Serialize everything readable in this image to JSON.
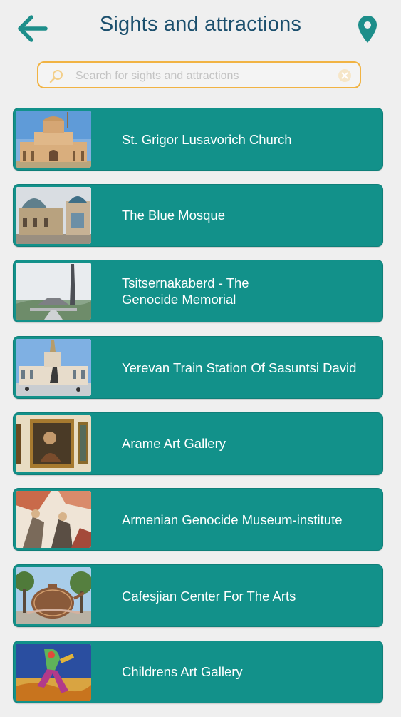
{
  "header": {
    "title": "Sights and attractions",
    "back_icon": "arrow-left-icon",
    "map_icon": "map-pin-icon",
    "accent_color": "#1d8e8a",
    "title_color": "#1b4f6d"
  },
  "search": {
    "placeholder": "Search for sights and attractions",
    "value": "",
    "border_color": "#f1b343"
  },
  "list": {
    "item_color": "#12918a",
    "items": [
      {
        "label": "St. Grigor Lusavorich Church"
      },
      {
        "label": "The Blue Mosque"
      },
      {
        "label": "Tsitsernakaberd - The\nGenocide Memorial"
      },
      {
        "label": "Yerevan Train Station Of Sasuntsi David"
      },
      {
        "label": "Arame Art Gallery"
      },
      {
        "label": "Armenian Genocide Museum-institute"
      },
      {
        "label": "Cafesjian Center For The Arts"
      },
      {
        "label": "Childrens Art Gallery"
      }
    ]
  }
}
